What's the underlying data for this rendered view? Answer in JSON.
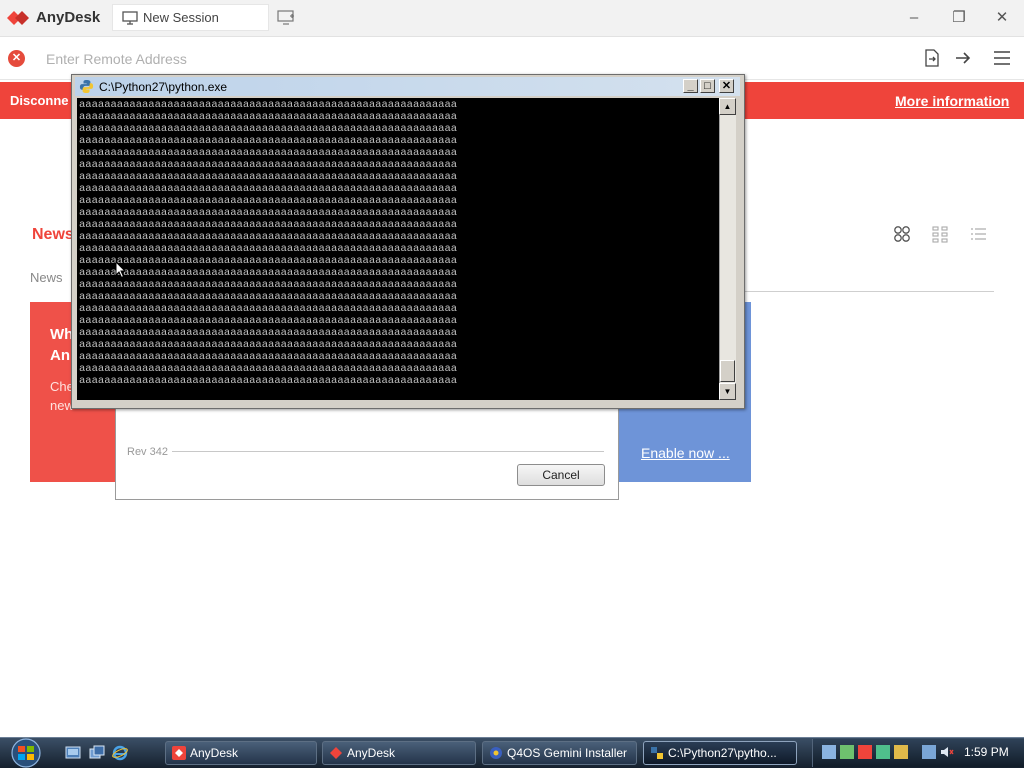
{
  "anydesk": {
    "app_name": "AnyDesk",
    "tab_label": "New Session",
    "address_placeholder": "Enter Remote Address",
    "banner_text": "Disconne",
    "banner_more": "More information",
    "news_title": "News",
    "news_tab": "News",
    "card_red_title_1": "Wh",
    "card_red_title_2": "An",
    "card_red_text_1": "Che",
    "card_red_text_2": "new",
    "enable_link": "Enable now ...",
    "brand_color": "#ef443b"
  },
  "dialog": {
    "rev_label": "Rev 342",
    "cancel_label": "Cancel"
  },
  "console": {
    "title": "C:\\Python27\\python.exe",
    "minimize_glyph": "_",
    "maximize_glyph": "□",
    "close_glyph": "✕",
    "line_text": "aaaaaaaaaaaaaaaaaaaaaaaaaaaaaaaaaaaaaaaaaaaaaaaaaaaaaaaaaaaa",
    "line_count": 24
  },
  "taskbar": {
    "items": [
      {
        "label": "AnyDesk"
      },
      {
        "label": "AnyDesk"
      },
      {
        "label": "Q4OS Gemini Installer"
      },
      {
        "label": "C:\\Python27\\pytho..."
      }
    ],
    "clock": "1:59 PM"
  }
}
